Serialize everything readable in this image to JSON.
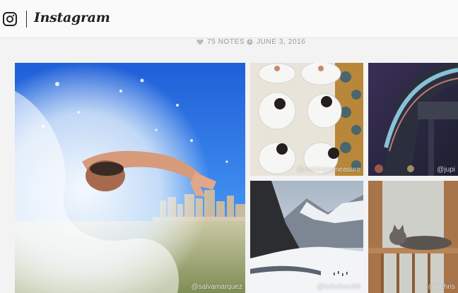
{
  "header": {
    "brand": "Instagram",
    "logo_icon": "instagram-camera-icon"
  },
  "post_meta": {
    "notes": "75 NOTES",
    "date": "JUNE 3, 2016",
    "notes_icon": "heart-icon",
    "date_icon": "clock-icon"
  },
  "photos": [
    {
      "credit": "@salvamarquez"
    },
    {
      "credit": "@nothingtomeasure"
    },
    {
      "credit": "@jupi"
    },
    {
      "credit": "@bobolsen88"
    },
    {
      "credit": "@wchris"
    }
  ],
  "colors": {
    "header_bg": "#fafafa",
    "page_bg": "#f3f3f3",
    "meta_text": "#9a9a9a"
  }
}
